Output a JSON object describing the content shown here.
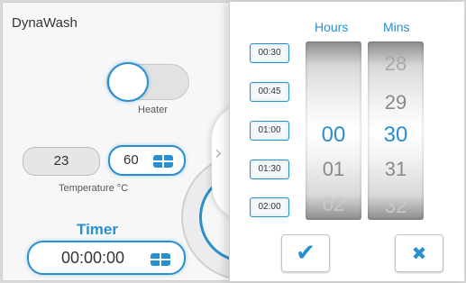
{
  "app": {
    "title": "DynaWash",
    "heater_label": "Heater",
    "temperature_current": "23",
    "temperature_setpoint": "60",
    "temperature_label": "Temperature °C",
    "timer_title": "Timer",
    "timer_value": "00:00:00"
  },
  "panel": {
    "hours_header": "Hours",
    "mins_header": "Mins",
    "presets": [
      "00:30",
      "00:45",
      "01:00",
      "01:30",
      "02:00"
    ],
    "hours_visible": [
      "",
      "",
      "00",
      "01",
      "02"
    ],
    "mins_visible": [
      "28",
      "29",
      "30",
      "31",
      "32"
    ],
    "ok_icon": "✔",
    "cancel_icon": "✖",
    "chevron": "›"
  },
  "colors": {
    "accent": "#2a8fd0"
  }
}
